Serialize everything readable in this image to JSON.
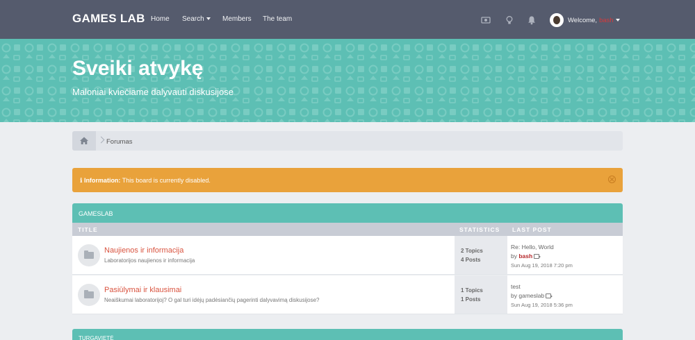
{
  "navbar": {
    "brand": "GAMES LAB",
    "links": {
      "home": "Home",
      "search": "Search",
      "members": "Members",
      "team": "The team"
    },
    "welcome_prefix": "Welcome,",
    "username": "bash",
    "colors": {
      "background": "#555b6d",
      "username": "#d8393b"
    }
  },
  "banner": {
    "title": "Sveiki atvykę",
    "subtitle": "Maloniai kviečiame dalyvauti diskusijose",
    "color": "#5dbfb4"
  },
  "breadcrumb": {
    "current": "Forumas"
  },
  "alert": {
    "label": "Information:",
    "message": "This board is currently disabled.",
    "color": "#e9a23b"
  },
  "forum": {
    "category": "GAMESLAB",
    "columns": {
      "title": "TITLE",
      "statistics": "STATISTICS",
      "last_post": "LAST POST"
    },
    "rows": [
      {
        "title": "Naujienos ir informacija",
        "description": "Laboratorijos naujienos ir informacija",
        "topics": "2 Topics",
        "posts": "4 Posts",
        "last_post_title": "Re: Hello, World",
        "by_label": "by",
        "last_post_author": "bash",
        "last_post_date": "Sun Aug 19, 2018 7:20 pm"
      },
      {
        "title": "Pasiūlymai ir klausimai",
        "description": "Neaiškumai laboratorijoj? O gal turi idėjų padėsiančių pagerinti dalyvavimą diskusijose?",
        "topics": "1 Topics",
        "posts": "1 Posts",
        "last_post_title": "test",
        "by_label": "by",
        "last_post_author": "gameslab",
        "last_post_date": "Sun Aug 19, 2018 5:36 pm"
      }
    ]
  },
  "next_category": "TURGAVIETĖ"
}
